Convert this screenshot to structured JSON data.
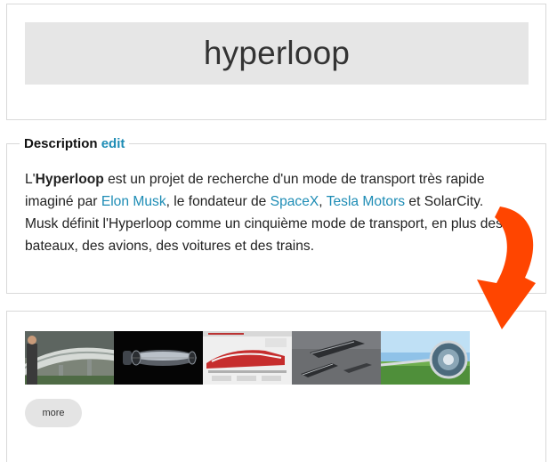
{
  "title": "hyperloop",
  "description": {
    "legend": "Description",
    "edit_label": "edit",
    "t1": "L'",
    "t2": "Hyperloop",
    "t3": " est un projet de recherche d'un mode de transport très rapide",
    "t4": "imaginé par ",
    "link_musk": "Elon Musk",
    "t5": ", le fondateur de ",
    "link_spacex": "SpaceX",
    "t6": ", ",
    "link_tesla": "Tesla Motors",
    "t7": " et SolarCity.",
    "t8": "Musk définit l'Hyperloop comme un cinquième mode de transport, en plus des",
    "t9": "bateaux, des avions, des voitures et des trains."
  },
  "gallery": {
    "thumbnails": [
      {
        "icon": "hyperloop-tube-elevated-photo"
      },
      {
        "icon": "hyperloop-capsule-dark-render"
      },
      {
        "icon": "hyperloop-infographic"
      },
      {
        "icon": "hyperloop-capsule-grey-render"
      },
      {
        "icon": "hyperloop-tube-landscape-photo"
      }
    ],
    "more_label": "more"
  },
  "colors": {
    "link": "#1d8cb5",
    "title_box": "#e6e6e6",
    "more_button": "#e4e4e4",
    "arrow": "#ff4500"
  },
  "annotation": {
    "icon": "curved-arrow-icon"
  }
}
